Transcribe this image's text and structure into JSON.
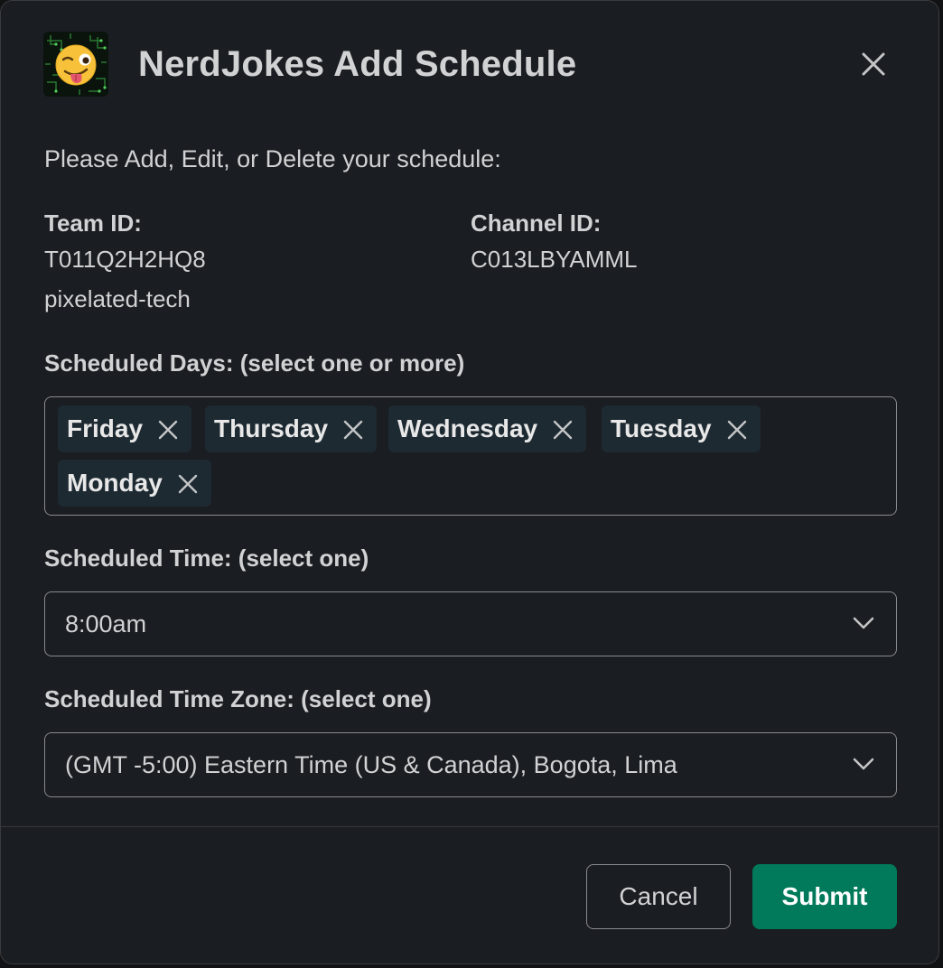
{
  "modal": {
    "title": "NerdJokes Add Schedule",
    "app_icon": "winking-tongue-emoji-circuit-icon",
    "close_icon": "close-icon"
  },
  "intro_text": "Please Add, Edit, or Delete your schedule:",
  "team": {
    "label": "Team ID:",
    "id": "T011Q2H2HQ8",
    "name": "pixelated-tech"
  },
  "channel": {
    "label": "Channel ID:",
    "id": "C013LBYAMML"
  },
  "days": {
    "label": "Scheduled Days: (select one or more)",
    "selected": [
      "Friday",
      "Thursday",
      "Wednesday",
      "Tuesday",
      "Monday"
    ]
  },
  "time": {
    "label": "Scheduled Time: (select one)",
    "value": "8:00am"
  },
  "timezone": {
    "label": "Scheduled Time Zone: (select one)",
    "value": "(GMT -5:00) Eastern Time (US & Canada), Bogota, Lima"
  },
  "buttons": {
    "cancel": "Cancel",
    "submit": "Submit"
  },
  "colors": {
    "background": "#1a1d21",
    "submit": "#007a5a",
    "chip": "#1e2a32",
    "border": "#8a8b8d"
  }
}
